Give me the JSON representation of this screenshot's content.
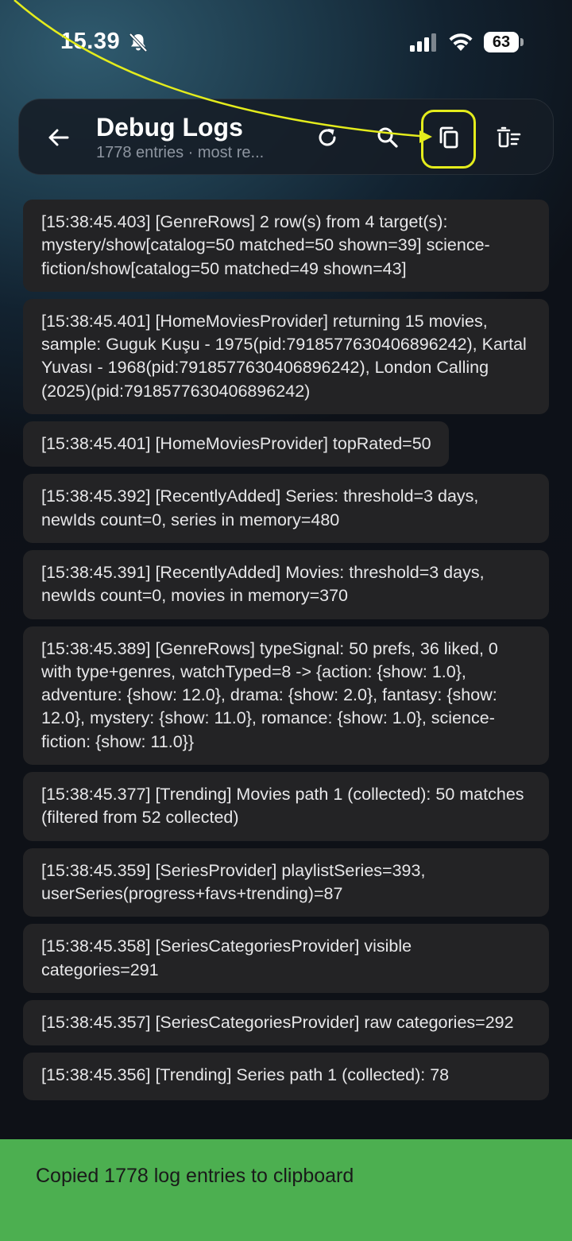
{
  "status_bar": {
    "time": "15.39",
    "battery": "63"
  },
  "app_bar": {
    "title": "Debug Logs",
    "subtitle": "1778 entries · most re..."
  },
  "logs": [
    "[15:38:45.403] [GenreRows] 2 row(s) from 4 target(s): mystery/show[catalog=50 matched=50 shown=39] science-fiction/show[catalog=50 matched=49 shown=43]",
    "[15:38:45.401] [HomeMoviesProvider] returning 15 movies, sample: Guguk Kuşu - 1975(pid:7918577630406896242), Kartal Yuvası - 1968(pid:7918577630406896242), London Calling (2025)(pid:7918577630406896242)",
    "[15:38:45.401] [HomeMoviesProvider] topRated=50",
    "[15:38:45.392] [RecentlyAdded] Series: threshold=3 days, newIds count=0, series in memory=480",
    "[15:38:45.391] [RecentlyAdded] Movies: threshold=3 days, newIds count=0, movies in memory=370",
    "[15:38:45.389] [GenreRows] typeSignal: 50 prefs, 36 liked, 0 with type+genres, watchTyped=8 -> {action: {show: 1.0}, adventure: {show: 12.0}, drama: {show: 2.0}, fantasy: {show: 12.0}, mystery: {show: 11.0}, romance: {show: 1.0}, science-fiction: {show: 11.0}}",
    "[15:38:45.377] [Trending] Movies path 1 (collected): 50 matches (filtered from 52 collected)",
    "[15:38:45.359] [SeriesProvider] playlistSeries=393, userSeries(progress+favs+trending)=87",
    "[15:38:45.358] [SeriesCategoriesProvider] visible categories=291",
    "[15:38:45.357] [SeriesCategoriesProvider] raw categories=292",
    "[15:38:45.356] [Trending] Series path 1 (collected): 78"
  ],
  "snackbar": {
    "message": "Copied 1778 log entries to clipboard"
  },
  "colors": {
    "snackbar_bg": "#4caf50",
    "annotation": "#e4ec1c",
    "card_bg": "#232325"
  },
  "icons": [
    "back-arrow-icon",
    "refresh-icon",
    "search-icon",
    "copy-icon",
    "clear-list-icon",
    "bell-off-icon",
    "signal-icon",
    "wifi-icon",
    "battery-icon"
  ]
}
